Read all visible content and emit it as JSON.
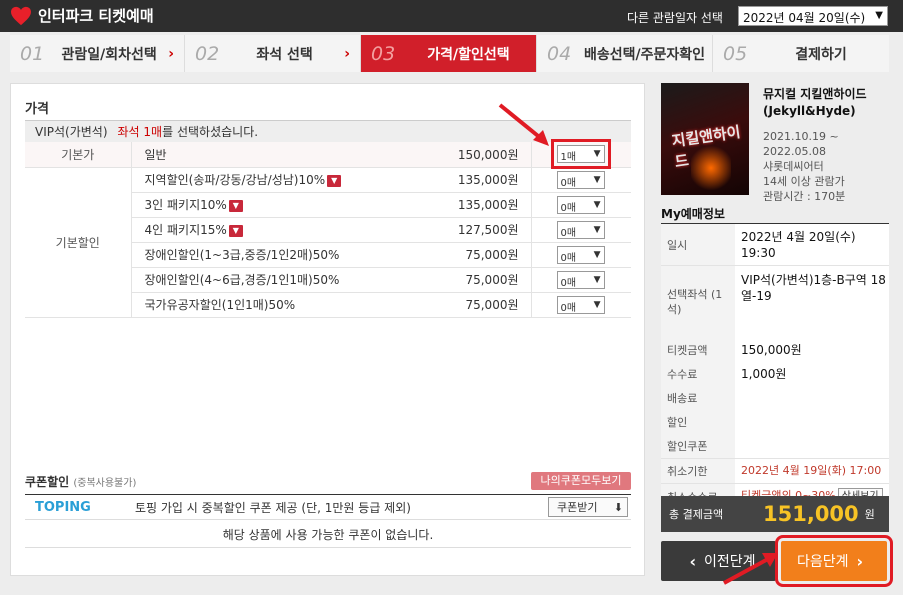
{
  "header": {
    "logo_text": "인터파크 티켓예매",
    "date_label": "다른 관람일자 선택",
    "date_value": "2022년 04월 20일(수)"
  },
  "steps": [
    {
      "num": "01",
      "label": "관람일/회차선택"
    },
    {
      "num": "02",
      "label": "좌석 선택"
    },
    {
      "num": "03",
      "label": "가격/할인선택"
    },
    {
      "num": "04",
      "label": "배송선택/주문자확인"
    },
    {
      "num": "05",
      "label": "결제하기"
    }
  ],
  "price": {
    "title": "가격",
    "seat_grade": "VIP석(가변석)",
    "notice_red": "좌석 1매",
    "notice_rest": "를 선택하셨습니다.",
    "base_category": "기본가",
    "discount_category": "기본할인",
    "rows": [
      {
        "name": "일반",
        "price": "150,000원",
        "qty": "1매"
      },
      {
        "name": "지역할인(송파/강동/강남/성남)10%",
        "price": "135,000원",
        "qty": "0매"
      },
      {
        "name": "3인 패키지10%",
        "price": "135,000원",
        "qty": "0매"
      },
      {
        "name": "4인 패키지15%",
        "price": "127,500원",
        "qty": "0매"
      },
      {
        "name": "장애인할인(1~3급,중증/1인2매)50%",
        "price": "75,000원",
        "qty": "0매"
      },
      {
        "name": "장애인할인(4~6급,경증/1인1매)50%",
        "price": "75,000원",
        "qty": "0매"
      },
      {
        "name": "국가유공자할인(1인1매)50%",
        "price": "75,000원",
        "qty": "0매"
      }
    ]
  },
  "coupon": {
    "title": "쿠폰할인",
    "subtitle": "(중복사용불가)",
    "all_button": "나의쿠폰모두보기",
    "brand": "TOPING",
    "desc": "토핑 가입 시 중복할인 쿠폰 제공 (단, 1만원 등급 제외)",
    "receive_button": "쿠폰받기",
    "empty": "해당 상품에 사용 가능한 쿠폰이 없습니다."
  },
  "show": {
    "title": "뮤지컬 지킬앤하이드 (Jekyll&Hyde)",
    "period": "2021.10.19 ~ 2022.05.08",
    "venue": "샤롯데씨어터",
    "age": "14세 이상 관람가",
    "runtime": "관람시간 : 170분",
    "poster_text": "지킬앤하이드"
  },
  "my": {
    "title": "My예매정보",
    "date_k": "일시",
    "date_v": "2022년 4월 20일(수) 19:30",
    "seat_k": "선택좌석 (1석)",
    "seat_v": "VIP석(가변석)1층-B구역 18열-19",
    "ticket_k": "티켓금액",
    "ticket_v": "150,000원",
    "fee_k": "수수료",
    "fee_v": "1,000원",
    "ship_k": "배송료",
    "disc_k": "할인",
    "coupon_k": "할인쿠폰",
    "cancel_deadline_k": "취소기한",
    "cancel_deadline_v": "2022년 4월 19일(화) 17:00",
    "cancel_fee_k": "취소수수료",
    "cancel_fee_v": "티켓금액의 0~30%",
    "detail_button": "상세보기",
    "total_k": "총 결제금액",
    "total_v": "151,000",
    "total_unit": "원"
  },
  "nav": {
    "prev": "이전단계",
    "next": "다음단계"
  },
  "colors": {
    "accent_red": "#d11f2a",
    "next_orange": "#f27f1b",
    "total_yellow": "#f7c325",
    "annotation_red": "#e01b24"
  }
}
